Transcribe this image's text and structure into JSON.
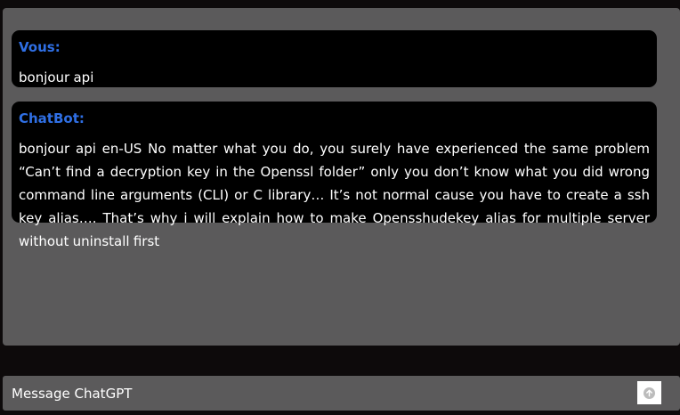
{
  "conversation": {
    "messages": [
      {
        "sender": "Vous:",
        "text": "bonjour api"
      },
      {
        "sender": "ChatBot:",
        "text": "bonjour api en-US No matter what you do, you surely have experienced the same problem “Can’t find a decryption key in the Openssl folder” only you don’t know what you did wrong command line arguments (CLI) or C library… It’s not normal cause you have to create a ssh key alias…. That’s why i will explain how to make Opensshudekey alias for multiple server without uninstall first"
      }
    ]
  },
  "composer": {
    "placeholder": "Message ChatGPT",
    "send_icon": "arrow-up-icon"
  },
  "colors": {
    "page_background": "#0d0a0b",
    "panel_background": "#5b5a5b",
    "bubble_background": "#000000",
    "sender_color": "#2f6fe4",
    "text_color": "#ffffff"
  }
}
